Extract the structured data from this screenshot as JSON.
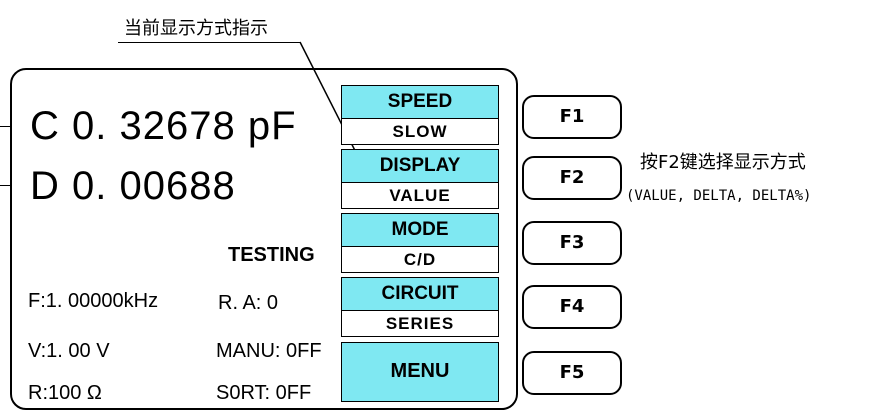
{
  "callout": {
    "title": "当前显示方式指示"
  },
  "display": {
    "c_line": "C 0. 32678 pF",
    "d_line": "D 0. 00688",
    "status": "TESTING",
    "freq": "F:1. 00000kHz",
    "range": "R. A:  0",
    "voltage": "V:1. 00 V",
    "manu": "MANU: 0FF",
    "resistance": "R:100  Ω",
    "sort": "S0RT: 0FF"
  },
  "softkeys": [
    {
      "title": "SPEED",
      "value": "SLOW"
    },
    {
      "title": "DISPLAY",
      "value": "VALUE"
    },
    {
      "title": "MODE",
      "value": "C/D"
    },
    {
      "title": "CIRCUIT",
      "value": "SERIES"
    }
  ],
  "menu_label": "MENU",
  "fkeys": [
    "F1",
    "F2",
    "F3",
    "F4",
    "F5"
  ],
  "note": {
    "line1": "按F2键选择显示方式",
    "line2": "(VALUE, DELTA, DELTA%)"
  },
  "colors": {
    "softkey_fill": "#7fe8f2",
    "border": "#000000",
    "background": "#ffffff"
  }
}
